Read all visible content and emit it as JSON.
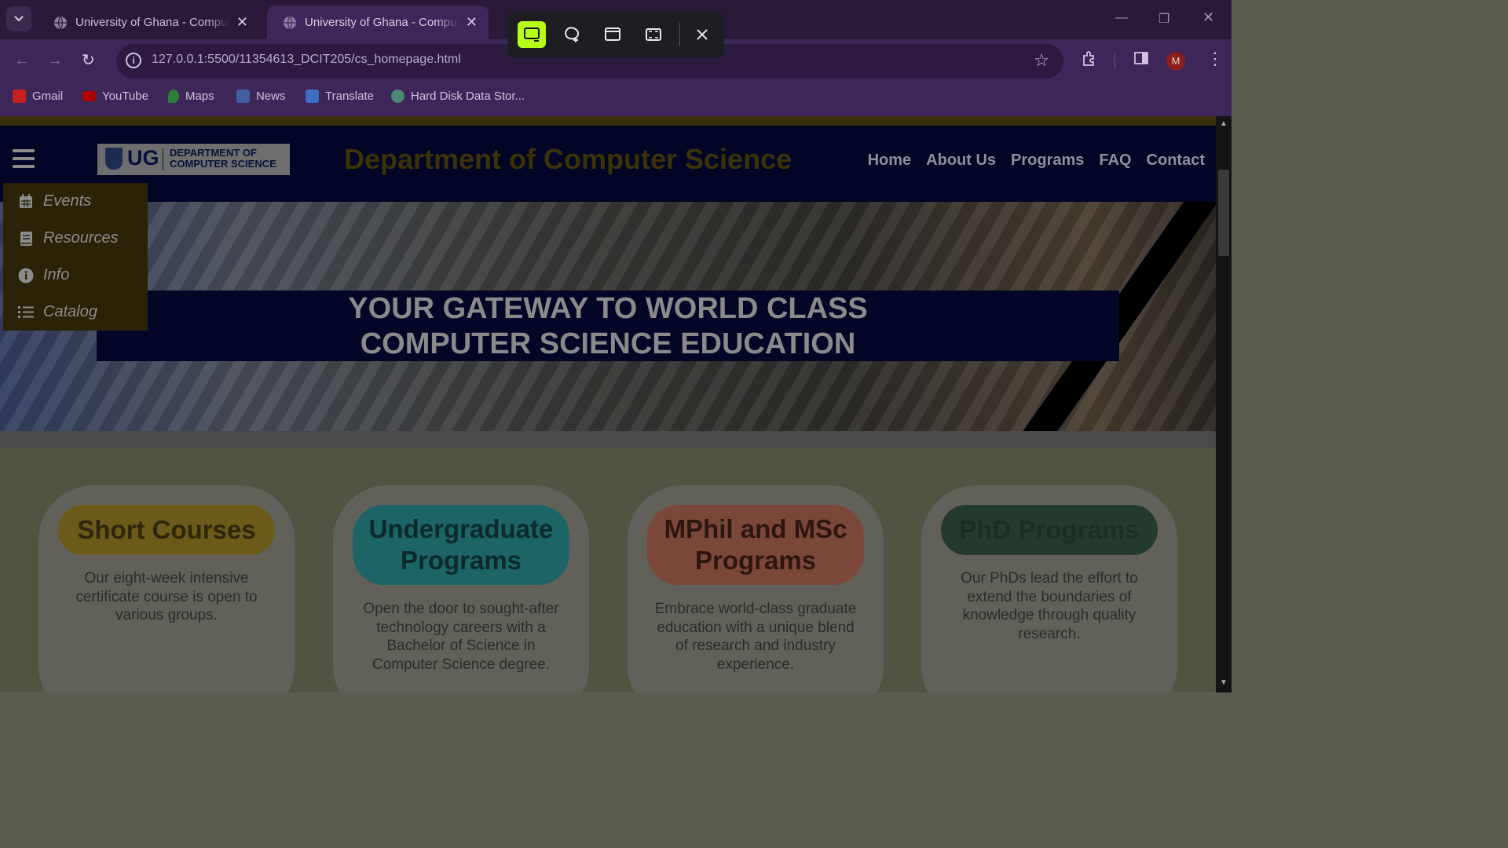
{
  "browser": {
    "tabs": [
      {
        "title": "University of Ghana - Computer Science",
        "active": false
      },
      {
        "title": "University of Ghana - Computer Science",
        "active": true
      }
    ],
    "url": "127.0.0.1:5500/11354613_DCIT205/cs_homepage.html",
    "profile_initial": "M",
    "bookmarks": [
      {
        "label": "Gmail",
        "icon": "gmail-icon",
        "color": "#c5221f"
      },
      {
        "label": "YouTube",
        "icon": "youtube-icon",
        "color": "#b00000"
      },
      {
        "label": "Maps",
        "icon": "maps-icon",
        "color": "#2f7d3b"
      },
      {
        "label": "News",
        "icon": "news-icon",
        "color": "#3f5fa0"
      },
      {
        "label": "Translate",
        "icon": "translate-icon",
        "color": "#3c6fc4"
      },
      {
        "label": "Hard Disk Data Stor...",
        "icon": "chatgpt-icon",
        "color": "#4a8a74"
      }
    ]
  },
  "snipping_toolbar": {
    "modes": [
      "rectangle-mode",
      "freeform-mode",
      "window-mode",
      "fullscreen-mode"
    ],
    "active_mode": "rectangle-mode",
    "accent": "#b7ff17"
  },
  "site": {
    "logo": {
      "abbr": "UG",
      "line1": "DEPARTMENT OF",
      "line2": "COMPUTER SCIENCE"
    },
    "title": "Department of Computer Science",
    "nav": [
      "Home",
      "About Us",
      "Programs",
      "FAQ",
      "Contact"
    ],
    "side_menu": [
      {
        "label": "Events",
        "icon": "calendar-icon"
      },
      {
        "label": "Resources",
        "icon": "book-icon"
      },
      {
        "label": "Info",
        "icon": "info-icon"
      },
      {
        "label": "Catalog",
        "icon": "list-icon"
      }
    ],
    "hero": {
      "line1": "YOUR GATEWAY TO WORLD CLASS",
      "line2": "COMPUTER SCIENCE EDUCATION"
    },
    "cards": [
      {
        "title": "Short Courses",
        "desc": "Our eight-week intensive certificate course is open to various groups.",
        "pill_color": "#6c5a1a",
        "title_color": "#2e270a"
      },
      {
        "title": "Undergraduate Programs",
        "desc": "Open the door to sought-after technology careers with a Bachelor of Science in Computer Science degree.",
        "pill_color": "#1c6466",
        "title_color": "#0c2a2c"
      },
      {
        "title": "MPhil and MSc Programs",
        "desc": "Embrace world-class graduate education with a unique blend of research and industry experience.",
        "pill_color": "#7a4738",
        "title_color": "#2e1610"
      },
      {
        "title": "PhD Programs",
        "desc": "Our PhDs lead the effort to extend the boundaries of knowledge through quality research.",
        "pill_color": "#243a2e",
        "title_color": "#1c2e24"
      }
    ]
  }
}
